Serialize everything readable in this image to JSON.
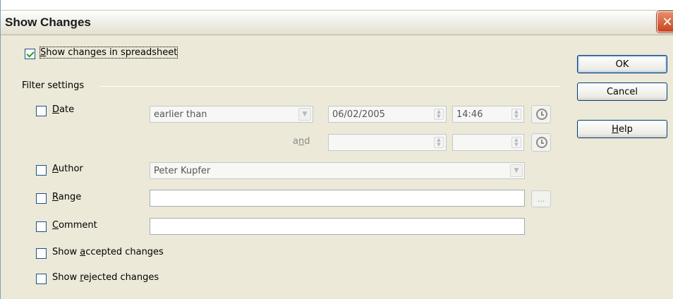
{
  "window": {
    "title": "Show Changes",
    "close_glyph": "✕"
  },
  "main": {
    "show_changes": {
      "label_pre": "",
      "label_key": "S",
      "label_post": "how changes in spreadsheet",
      "checked": true
    },
    "filter_settings_label": "Filter settings",
    "date": {
      "label_key": "D",
      "label_post": "ate",
      "checked": false,
      "condition": "earlier than",
      "date_value": "06/02/2005",
      "time_value": "14:46",
      "and_pre": "a",
      "and_key": "n",
      "and_post": "d",
      "date2_value": "",
      "time2_value": ""
    },
    "author": {
      "label_key": "A",
      "label_post": "uthor",
      "checked": false,
      "value": "Peter Kupfer"
    },
    "range": {
      "label_key": "R",
      "label_post": "ange",
      "checked": false,
      "value": "",
      "select_label": "..."
    },
    "comment": {
      "label_key": "C",
      "label_post": "omment",
      "checked": false,
      "value": ""
    },
    "show_accepted": {
      "label_pre": "Show ",
      "label_key": "a",
      "label_post": "ccepted changes",
      "checked": false
    },
    "show_rejected": {
      "label_pre": "Show ",
      "label_key": "r",
      "label_post": "ejected changes",
      "checked": false
    }
  },
  "buttons": {
    "ok": "OK",
    "cancel": "Cancel",
    "help_key": "H",
    "help_post": "elp"
  },
  "icons": {
    "dropdown": "chevron-down-icon",
    "spin": "spin-updown-icon",
    "clock": "clock-icon",
    "close": "close-icon"
  }
}
